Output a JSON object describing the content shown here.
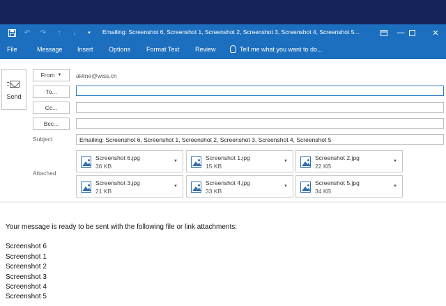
{
  "window": {
    "title": "Emailing: Screenshot 6, Screenshot 1, Screenshot 2, Screenshot 3, Screenshot 4, Screenshot 5...",
    "qat_icons": [
      "save-icon",
      "undo-icon",
      "redo-icon",
      "up-arrow-icon",
      "down-arrow-icon",
      "customize-qat-icon"
    ],
    "controls": [
      "ribbon-display-options-icon",
      "minimize-icon",
      "maximize-icon",
      "close-icon"
    ]
  },
  "ribbon": {
    "tabs": [
      "File",
      "Message",
      "Insert",
      "Options",
      "Format Text",
      "Review"
    ],
    "tell_me": "Tell me what you want to do..."
  },
  "compose": {
    "send_label": "Send",
    "from_label": "From",
    "from_value": "akline@wiss.cn",
    "to_label": "To...",
    "cc_label": "Cc...",
    "bcc_label": "Bcc...",
    "subject_label": "Subject",
    "subject_value": "Emailing: Screenshot 6, Screenshot 1, Screenshot 2, Screenshot 3, Screenshot 4, Screenshot 5",
    "attached_label": "Attached",
    "attachments": [
      {
        "name": "Screenshot 6.jpg",
        "size": "36 KB"
      },
      {
        "name": "Screenshot 1.jpg",
        "size": "15 KB"
      },
      {
        "name": "Screenshot 2.jpg",
        "size": "22 KB"
      },
      {
        "name": "Screenshot 3.jpg",
        "size": "21 KB"
      },
      {
        "name": "Screenshot 4.jpg",
        "size": "33 KB"
      },
      {
        "name": "Screenshot 5.jpg",
        "size": "34 KB"
      }
    ]
  },
  "body": {
    "intro": "Your message is ready to be sent with the following file or link attachments:",
    "lines": [
      "Screenshot 6",
      "Screenshot 1",
      "Screenshot 2",
      "Screenshot 3",
      "Screenshot 4",
      "Screenshot 5"
    ]
  },
  "colors": {
    "title_band": "#16225a",
    "ribbon_blue": "#1c6fbe",
    "active_field_border": "#2b79c8"
  }
}
